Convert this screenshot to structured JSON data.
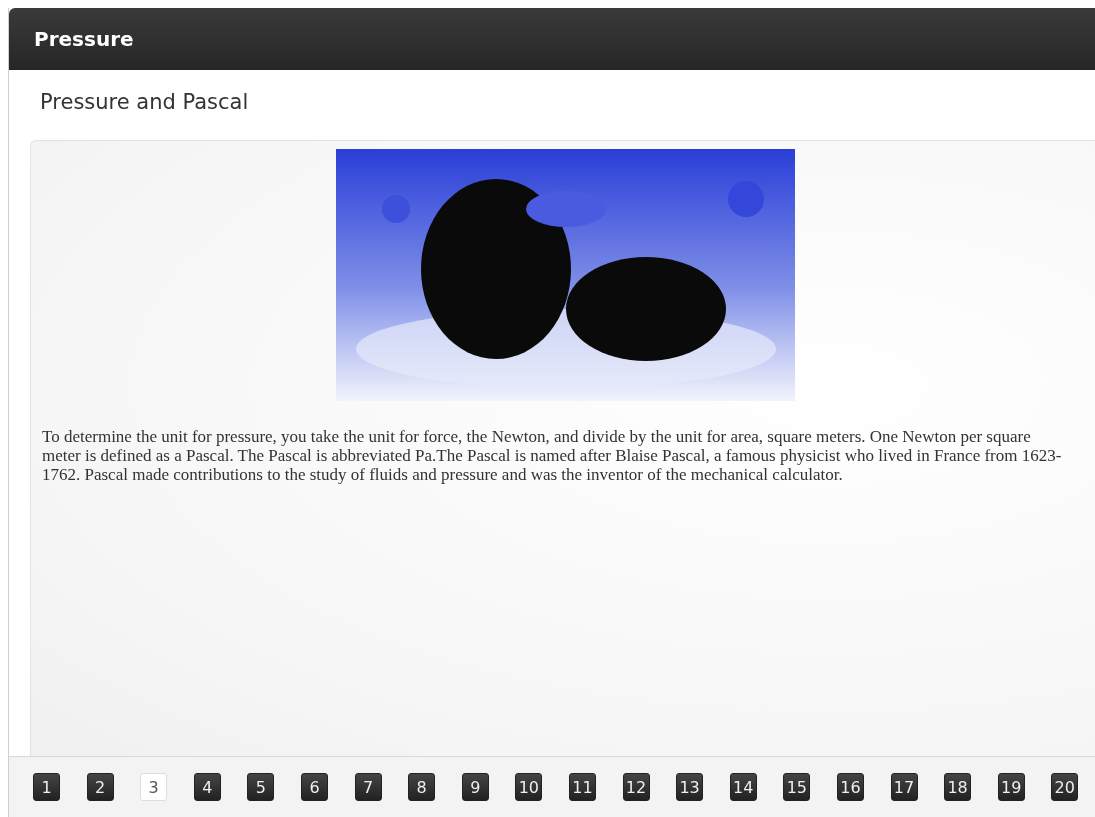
{
  "window": {
    "title": "Pressure"
  },
  "page": {
    "heading": "Pressure and Pascal",
    "paragraph": "To determine the unit for pressure, you take the unit for force, the Newton, and divide by the unit for area, square meters. One Newton per square meter is defined as a Pascal. The Pascal is abbreviated Pa.The Pascal is named after Blaise Pascal, a famous physicist who lived in France from 1623-1762. Pascal made contributions to the study of fluids and pressure and was the inventor of the mechanical calculator."
  },
  "pager": [
    {
      "label": "1",
      "selected": false
    },
    {
      "label": "2",
      "selected": false
    },
    {
      "label": "3",
      "selected": true
    },
    {
      "label": "4",
      "selected": false
    },
    {
      "label": "5",
      "selected": false
    },
    {
      "label": "6",
      "selected": false
    },
    {
      "label": "7",
      "selected": false
    },
    {
      "label": "8",
      "selected": false
    },
    {
      "label": "9",
      "selected": false
    },
    {
      "label": "10",
      "selected": false
    },
    {
      "label": "11",
      "selected": false
    },
    {
      "label": "12",
      "selected": false
    },
    {
      "label": "13",
      "selected": false
    },
    {
      "label": "14",
      "selected": false
    },
    {
      "label": "15",
      "selected": false
    },
    {
      "label": "16",
      "selected": false
    },
    {
      "label": "17",
      "selected": false
    },
    {
      "label": "18",
      "selected": false
    },
    {
      "label": "19",
      "selected": false
    },
    {
      "label": "20",
      "selected": false
    }
  ]
}
